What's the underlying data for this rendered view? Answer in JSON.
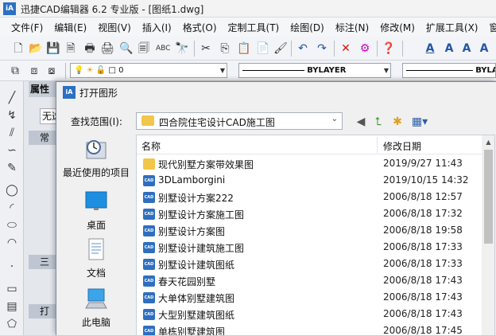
{
  "window": {
    "app_icon": "iA",
    "title": "迅捷CAD编辑器 6.2 专业版 - [图纸1.dwg]"
  },
  "menu": [
    "文件(F)",
    "编辑(E)",
    "视图(V)",
    "插入(I)",
    "格式(O)",
    "定制工具(T)",
    "绘图(D)",
    "标注(N)",
    "修改(M)",
    "扩展工具(X)",
    "窗口"
  ],
  "toolbar2": {
    "layer_value": "0",
    "linetype_value": "BYLAYER",
    "lineweight_value": "BYLA"
  },
  "property_panel": {
    "head": "属性",
    "field": "无选",
    "band1": "常",
    "band2": "三",
    "band3": "打"
  },
  "dialog": {
    "title_icon": "iA",
    "title": "打开图形",
    "lookin_label": "查找范围(I):",
    "lookin_value": "四合院住宅设计CAD施工图",
    "places": [
      {
        "label": "最近使用的项目",
        "icon": "recent-icon"
      },
      {
        "label": "桌面",
        "icon": "desktop-icon"
      },
      {
        "label": "文档",
        "icon": "documents-icon"
      },
      {
        "label": "此电脑",
        "icon": "computer-icon"
      }
    ],
    "columns": {
      "name": "名称",
      "date": "修改日期"
    },
    "files": [
      {
        "name": "现代别墅方案带效果图",
        "date": "2019/9/27 11:43",
        "type": "folder"
      },
      {
        "name": "3DLamborgini",
        "date": "2019/10/15 14:32",
        "type": "cad"
      },
      {
        "name": "别墅设计方案222",
        "date": "2006/8/18 12:57",
        "type": "cad"
      },
      {
        "name": "别墅设计方案施工图",
        "date": "2006/8/18 17:32",
        "type": "cad"
      },
      {
        "name": "别墅设计方案图",
        "date": "2006/8/18 19:58",
        "type": "cad"
      },
      {
        "name": "别墅设计建筑施工图",
        "date": "2006/8/18 17:33",
        "type": "cad"
      },
      {
        "name": "别墅设计建筑图纸",
        "date": "2006/8/18 17:33",
        "type": "cad"
      },
      {
        "name": "春天花园别墅",
        "date": "2006/8/18 17:43",
        "type": "cad"
      },
      {
        "name": "大单体别墅建筑图",
        "date": "2006/8/18 17:43",
        "type": "cad"
      },
      {
        "name": "大型别墅建筑图纸",
        "date": "2006/8/18 17:43",
        "type": "cad"
      },
      {
        "name": "单栋别墅建筑图",
        "date": "2006/8/18 17:45",
        "type": "cad"
      }
    ],
    "cad_badge": "CAD"
  }
}
